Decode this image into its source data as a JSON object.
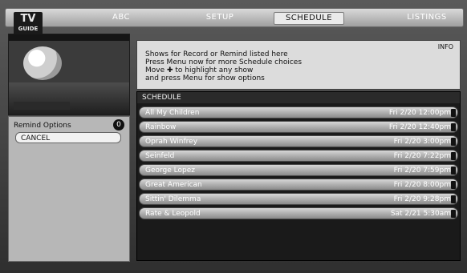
{
  "app": {
    "logo": {
      "main": "TV",
      "sub": "GUIDE"
    }
  },
  "topbar": {
    "search_label": "ABC",
    "setup_label": "SETUP",
    "schedule_label": "SCHEDULE",
    "listings_label": "LISTINGS"
  },
  "panel": {
    "info_label": "INFO",
    "info_lines": [
      "Shows for Record or Remind listed here",
      "Press Menu now for more Schedule choices",
      "Move ✚ to highlight any show",
      "and press Menu for show options"
    ]
  },
  "reminders": {
    "header": "Remind Options",
    "badge": "0",
    "cancel_label": "CANCEL"
  },
  "schedule": {
    "header": "SCHEDULE",
    "rows": [
      {
        "title": "All My Children",
        "time": "Fri  2/20  12:00pm"
      },
      {
        "title": "Rainbow",
        "time": "Fri  2/20  12:40pm"
      },
      {
        "title": "Oprah Winfrey",
        "time": "Fri  2/20  3:00pm"
      },
      {
        "title": "Seinfeld",
        "time": "Fri  2/20  7:22pm"
      },
      {
        "title": "George Lopez",
        "time": "Fri  2/20  7:59pm"
      },
      {
        "title": "Great American",
        "time": "Fri  2/20  8:00pm"
      },
      {
        "title": "Sittin' Dilemma",
        "time": "Fri  2/20  9:28pm"
      },
      {
        "title": "Rate & Leopold",
        "time": "Sat  2/21  5:30am"
      }
    ]
  }
}
